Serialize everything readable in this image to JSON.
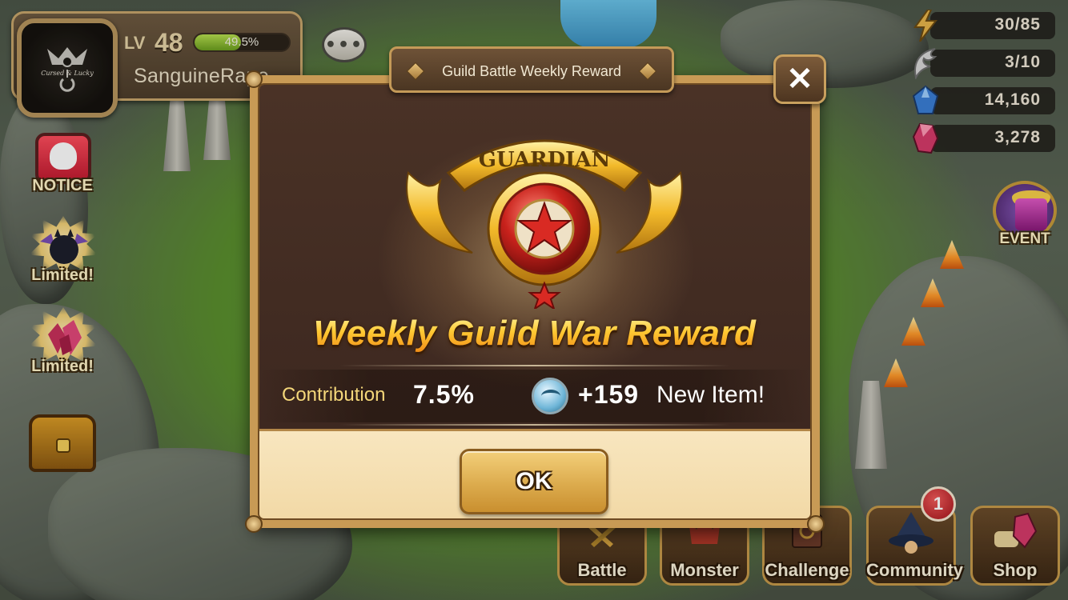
{
  "player": {
    "level_label": "LV",
    "level": "48",
    "xp_percent_text": "49.5%",
    "xp_fraction": 0.495,
    "name": "SanguineRape",
    "avatar_text": "Cursed & Lucky"
  },
  "resources": [
    {
      "name": "energy",
      "icon": "lightning-icon",
      "value": "30/85",
      "color": "#e8b54a"
    },
    {
      "name": "arena-wings",
      "icon": "wing-icon",
      "value": "3/10",
      "color": "#d9d9d9"
    },
    {
      "name": "mana-crystals",
      "icon": "blue-crystal-icon",
      "value": "14,160",
      "color": "#3b7fd6"
    },
    {
      "name": "crystals",
      "icon": "red-crystal-icon",
      "value": "3,278",
      "color": "#d63b6a"
    }
  ],
  "side": {
    "notice": "NOTICE",
    "limited_1": "Limited!",
    "limited_2": "Limited!"
  },
  "event_label": "EVENT",
  "nav": {
    "battle": "Battle",
    "monster": "Monster",
    "challenge": "Challenge",
    "community": "Community",
    "shop": "Shop",
    "community_badge": "1"
  },
  "modal": {
    "tab_title": "Guild Battle Weekly Reward",
    "emblem_text": "GUARDIAN",
    "headline": "Weekly Guild War Reward",
    "contribution_label": "Contribution",
    "contribution_value": "7.5%",
    "reward_value": "+159",
    "reward_note": "New Item!",
    "ok_label": "OK",
    "close_label": "✕"
  }
}
